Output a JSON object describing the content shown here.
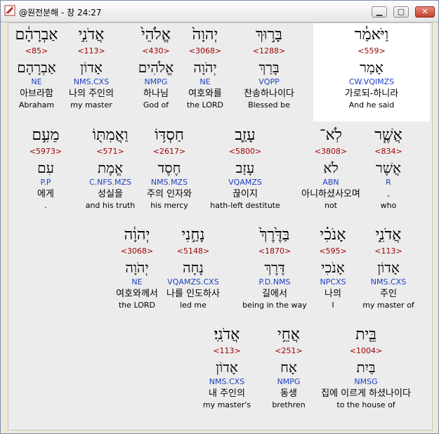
{
  "window": {
    "title": "@원전분해 - 창 24:27",
    "minimize_label": "▁",
    "maximize_label": "▢",
    "close_label": "✕"
  },
  "rows": [
    [
      {
        "hebrew": "וַיֹּאמַ֓ר",
        "num": "<559>",
        "lemma": "אָמַר",
        "code": "CW.VQIMZS",
        "ko": "가로되-하니라",
        "en": "And he said",
        "highlight": true
      },
      {
        "hebrew": "בָּר֣וּךְ",
        "num": "<1288>",
        "lemma": "בָּרַךְ",
        "code": "VQPP",
        "ko": "찬송하나이다",
        "en": "Blessed be"
      },
      {
        "hebrew": "יְהוָה֙",
        "num": "<3068>",
        "lemma": "יְהֹוָה",
        "code": "NE",
        "ko": "여호와를",
        "en": "the LORD"
      },
      {
        "hebrew": "אֱלֹהֵי֙",
        "num": "<430>",
        "lemma": "אֱלֹהִים",
        "code": "NMPG",
        "ko": "하나님",
        "en": "God of"
      },
      {
        "hebrew": "אֲדֹנִ֣י",
        "num": "<113>",
        "lemma": "אָדוֹן",
        "code": "NMS.CXS",
        "ko": "나의 주인의",
        "en": "my master"
      },
      {
        "hebrew": "אַבְרָהָ֔ם",
        "num": "<85>",
        "lemma": "אַבְרָהָם",
        "code": "NE",
        "ko": "아브라함",
        "en": "Abraham"
      }
    ],
    [
      {
        "hebrew": "אֲשֶׁ֧ר",
        "num": "<834>",
        "lemma": "אֲשֶׁר",
        "code": "R",
        "ko": ".",
        "en": "who"
      },
      {
        "hebrew": "לֹֽא־",
        "num": "<3808>",
        "lemma": "לֹא",
        "code": "ABN",
        "ko": "아니하셨사오며",
        "en": "not"
      },
      {
        "hebrew": "עָזַ֛ב",
        "num": "<5800>",
        "lemma": "עָזַב",
        "code": "VQAMZS",
        "ko": "끊이지",
        "en": "hath-left destitute"
      },
      {
        "hebrew": "חַסְדּ֥וֹ",
        "num": "<2617>",
        "lemma": "חֶסֶד",
        "code": "NMS.MZS",
        "ko": "주의 인자와",
        "en": "his mercy"
      },
      {
        "hebrew": "וַאֲמִתּ֖וֹ",
        "num": "<571>",
        "lemma": "אֱמֶת",
        "code": "C.NFS.MZS",
        "ko": "성실을",
        "en": "and his truth"
      },
      {
        "hebrew": "מֵעִ֣ם",
        "num": "<5973>",
        "lemma": "עִם",
        "code": "P.P",
        "ko": "에게",
        "en": "."
      }
    ],
    [
      {
        "hebrew": "אֲדֹנִ֑י",
        "num": "<113>",
        "lemma": "אָדוֹן",
        "code": "NMS.CXS",
        "ko": "주인",
        "en": "my master of"
      },
      {
        "hebrew": "אָנֹכִ֗י",
        "num": "<595>",
        "lemma": "אָנֹכִי",
        "code": "NPCXS",
        "ko": "나의",
        "en": "I"
      },
      {
        "hebrew": "בַּדֶּ֙רֶךְ֙",
        "num": "<1870>",
        "lemma": "דֶּרֶךְ",
        "code": "P.D.NMS",
        "ko": "길에서",
        "en": "being in the way"
      },
      {
        "hebrew": "נָחַ֣נִי",
        "num": "<5148>",
        "lemma": "נָחָה",
        "code": "VQAMZS.CXS",
        "ko": "나를 인도하사",
        "en": "led me"
      },
      {
        "hebrew": "יְהוָ֔ה",
        "num": "<3068>",
        "lemma": "יְהֹוָה",
        "code": "NE",
        "ko": "여호와께서",
        "en": "the LORD"
      }
    ],
    [
      {
        "hebrew": "בֵּ֖ית",
        "num": "<1004>",
        "lemma": "בַּיִת",
        "code": "NMSG",
        "ko": "집에 이르게 하셨나이다",
        "en": "to the house of"
      },
      {
        "hebrew": "אֲחֵ֥י",
        "num": "<251>",
        "lemma": "אָח",
        "code": "NMPG",
        "ko": "동생",
        "en": "brethren"
      },
      {
        "hebrew": "אֲדֹנִֽי׃",
        "num": "<113>",
        "lemma": "אָדוֹן",
        "code": "NMS.CXS",
        "ko": "내 주인의",
        "en": "my master's"
      }
    ]
  ]
}
